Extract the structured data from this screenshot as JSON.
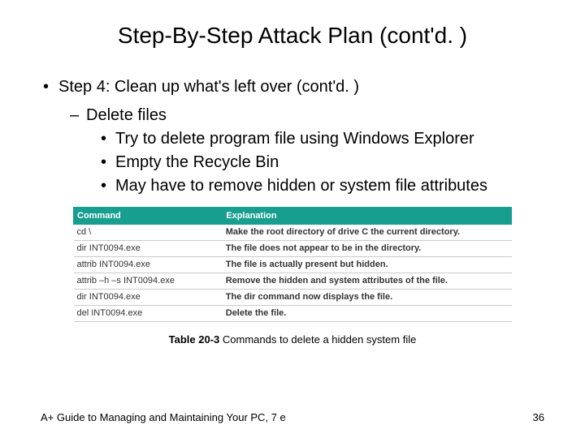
{
  "title": "Step-By-Step Attack Plan (cont'd. )",
  "bullets": {
    "step": "Step 4: Clean up what's left over (cont'd. )",
    "sub": "Delete files",
    "points": [
      "Try to delete program file using Windows Explorer",
      "Empty the Recycle Bin",
      "May have to remove hidden or system file attributes"
    ]
  },
  "table": {
    "headers": [
      "Command",
      "Explanation"
    ],
    "rows": [
      [
        "cd \\",
        "Make the root directory of drive C the current directory."
      ],
      [
        "dir INT0094.exe",
        "The file does not appear to be in the directory."
      ],
      [
        "attrib INT0094.exe",
        "The file is actually present but hidden."
      ],
      [
        "attrib –h –s INT0094.exe",
        "Remove the hidden and system attributes of the file."
      ],
      [
        "dir INT0094.exe",
        "The dir command now displays the file."
      ],
      [
        "del INT0094.exe",
        "Delete the file."
      ]
    ]
  },
  "caption_prefix": "Table 20-3 ",
  "caption_text": "Commands to delete a hidden system file",
  "footer_left": "A+ Guide to Managing and Maintaining Your PC, 7 e",
  "footer_right": "36"
}
